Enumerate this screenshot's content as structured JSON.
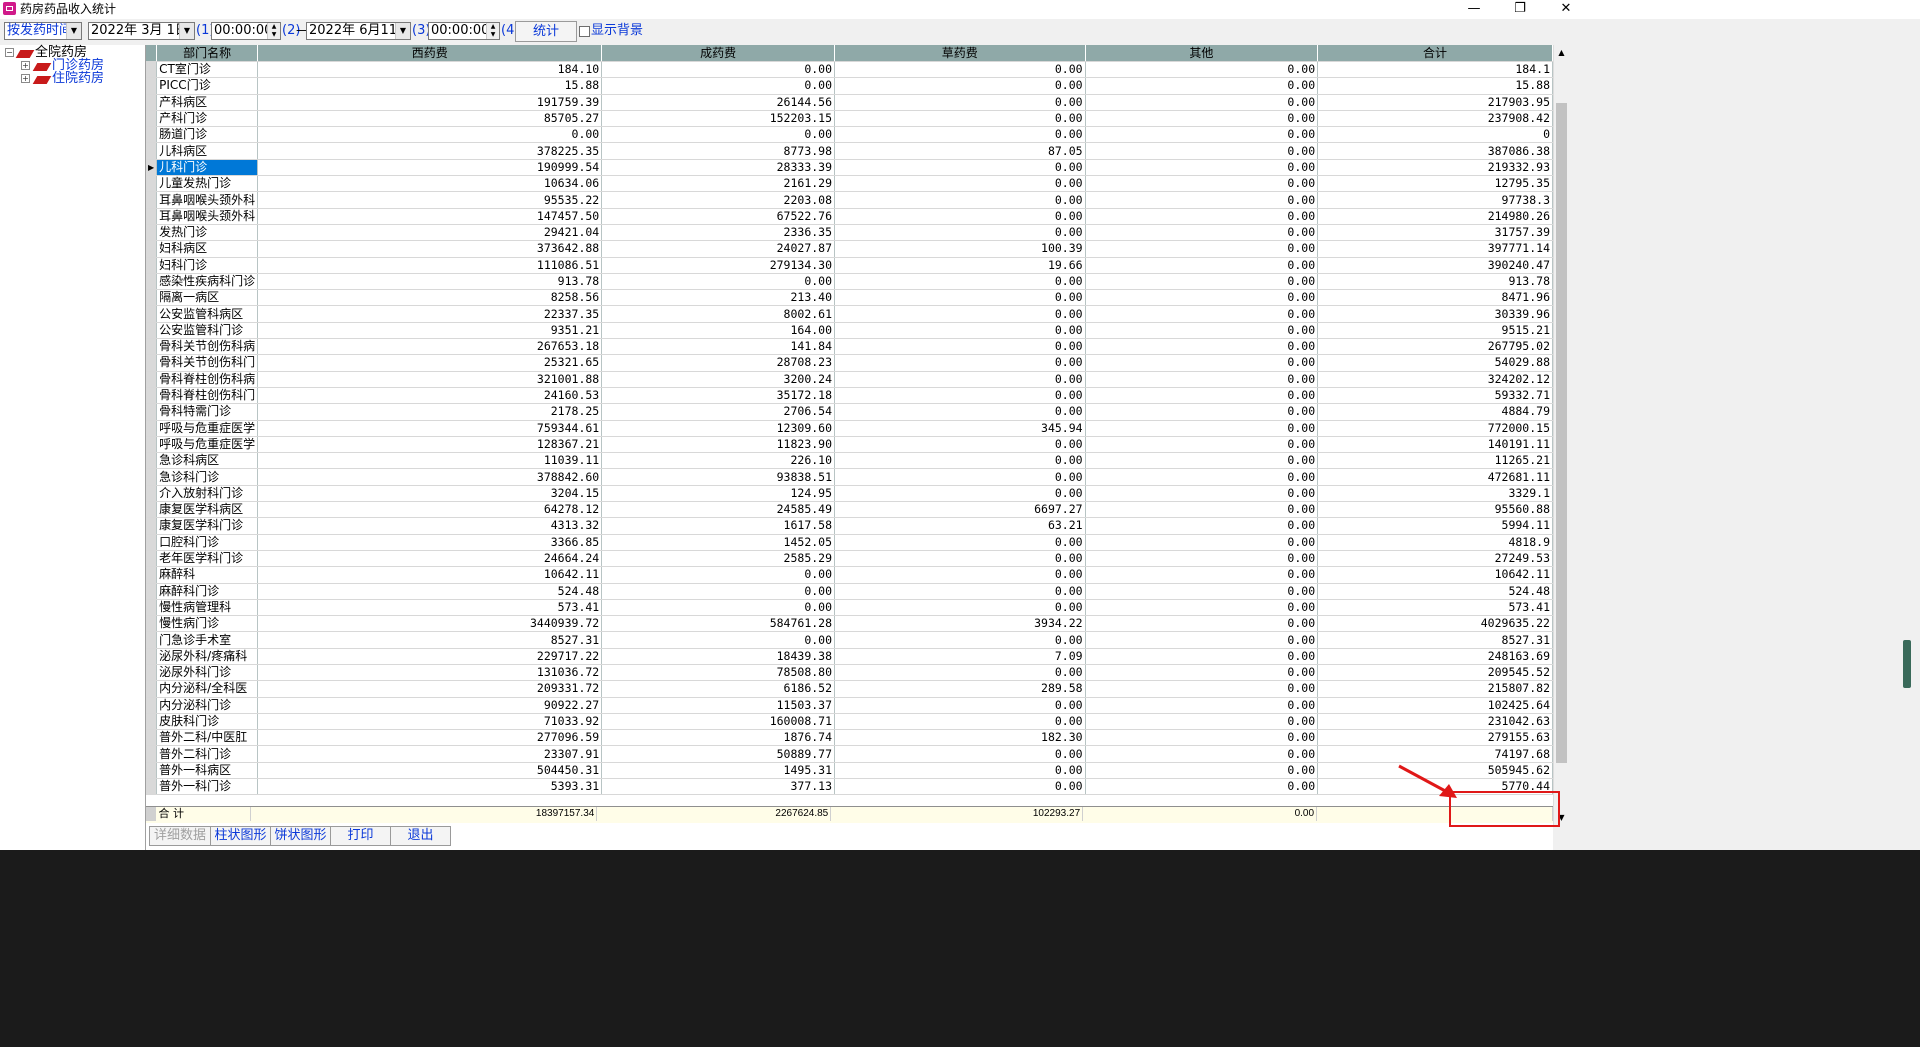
{
  "window": {
    "title": "药房药品收入统计",
    "minimize_icon": "minimize-icon",
    "maximize_icon": "restore-icon",
    "close_icon": "close-icon"
  },
  "toolbar": {
    "mode_select": "按发药时间",
    "start_date": "2022年  3月 1日",
    "start_time": "00:00:00",
    "marker1": "(1)",
    "marker2": "(2)",
    "separator": "—",
    "end_date": "2022年  6月11日",
    "marker3": "(3)",
    "end_time": "00:00:00",
    "marker4": "(4)",
    "stat_button": "统计",
    "show_background_label": "显示背景",
    "show_background_checked": false
  },
  "tree": {
    "root": "全院药房",
    "children": [
      "门诊药房",
      "住院药房"
    ],
    "link_color": "#0a38d8"
  },
  "grid": {
    "header_color": "#8fa9a8",
    "columns": [
      "部门名称",
      "西药费",
      "成药费",
      "草药费",
      "其他",
      "合计"
    ],
    "selected_row": 6,
    "rows": [
      [
        "CT室门诊",
        "184.10",
        "0.00",
        "0.00",
        "0.00",
        "184.1"
      ],
      [
        "PICC门诊",
        "15.88",
        "0.00",
        "0.00",
        "0.00",
        "15.88"
      ],
      [
        "产科病区",
        "191759.39",
        "26144.56",
        "0.00",
        "0.00",
        "217903.95"
      ],
      [
        "产科门诊",
        "85705.27",
        "152203.15",
        "0.00",
        "0.00",
        "237908.42"
      ],
      [
        "肠道门诊",
        "0.00",
        "0.00",
        "0.00",
        "0.00",
        "0"
      ],
      [
        "儿科病区",
        "378225.35",
        "8773.98",
        "87.05",
        "0.00",
        "387086.38"
      ],
      [
        "儿科门诊",
        "190999.54",
        "28333.39",
        "0.00",
        "0.00",
        "219332.93"
      ],
      [
        "儿童发热门诊",
        "10634.06",
        "2161.29",
        "0.00",
        "0.00",
        "12795.35"
      ],
      [
        "耳鼻咽喉头颈外科",
        "95535.22",
        "2203.08",
        "0.00",
        "0.00",
        "97738.3"
      ],
      [
        "耳鼻咽喉头颈外科",
        "147457.50",
        "67522.76",
        "0.00",
        "0.00",
        "214980.26"
      ],
      [
        "发热门诊",
        "29421.04",
        "2336.35",
        "0.00",
        "0.00",
        "31757.39"
      ],
      [
        "妇科病区",
        "373642.88",
        "24027.87",
        "100.39",
        "0.00",
        "397771.14"
      ],
      [
        "妇科门诊",
        "111086.51",
        "279134.30",
        "19.66",
        "0.00",
        "390240.47"
      ],
      [
        "感染性疾病科门诊",
        "913.78",
        "0.00",
        "0.00",
        "0.00",
        "913.78"
      ],
      [
        "隔离一病区",
        "8258.56",
        "213.40",
        "0.00",
        "0.00",
        "8471.96"
      ],
      [
        "公安监管科病区",
        "22337.35",
        "8002.61",
        "0.00",
        "0.00",
        "30339.96"
      ],
      [
        "公安监管科门诊",
        "9351.21",
        "164.00",
        "0.00",
        "0.00",
        "9515.21"
      ],
      [
        "骨科关节创伤科病",
        "267653.18",
        "141.84",
        "0.00",
        "0.00",
        "267795.02"
      ],
      [
        "骨科关节创伤科门",
        "25321.65",
        "28708.23",
        "0.00",
        "0.00",
        "54029.88"
      ],
      [
        "骨科脊柱创伤科病",
        "321001.88",
        "3200.24",
        "0.00",
        "0.00",
        "324202.12"
      ],
      [
        "骨科脊柱创伤科门",
        "24160.53",
        "35172.18",
        "0.00",
        "0.00",
        "59332.71"
      ],
      [
        "骨科特需门诊",
        "2178.25",
        "2706.54",
        "0.00",
        "0.00",
        "4884.79"
      ],
      [
        "呼吸与危重症医学",
        "759344.61",
        "12309.60",
        "345.94",
        "0.00",
        "772000.15"
      ],
      [
        "呼吸与危重症医学",
        "128367.21",
        "11823.90",
        "0.00",
        "0.00",
        "140191.11"
      ],
      [
        "急诊科病区",
        "11039.11",
        "226.10",
        "0.00",
        "0.00",
        "11265.21"
      ],
      [
        "急诊科门诊",
        "378842.60",
        "93838.51",
        "0.00",
        "0.00",
        "472681.11"
      ],
      [
        "介入放射科门诊",
        "3204.15",
        "124.95",
        "0.00",
        "0.00",
        "3329.1"
      ],
      [
        "康复医学科病区",
        "64278.12",
        "24585.49",
        "6697.27",
        "0.00",
        "95560.88"
      ],
      [
        "康复医学科门诊",
        "4313.32",
        "1617.58",
        "63.21",
        "0.00",
        "5994.11"
      ],
      [
        "口腔科门诊",
        "3366.85",
        "1452.05",
        "0.00",
        "0.00",
        "4818.9"
      ],
      [
        "老年医学科门诊",
        "24664.24",
        "2585.29",
        "0.00",
        "0.00",
        "27249.53"
      ],
      [
        "麻醉科",
        "10642.11",
        "0.00",
        "0.00",
        "0.00",
        "10642.11"
      ],
      [
        "麻醉科门诊",
        "524.48",
        "0.00",
        "0.00",
        "0.00",
        "524.48"
      ],
      [
        "慢性病管理科",
        "573.41",
        "0.00",
        "0.00",
        "0.00",
        "573.41"
      ],
      [
        "慢性病门诊",
        "3440939.72",
        "584761.28",
        "3934.22",
        "0.00",
        "4029635.22"
      ],
      [
        "门急诊手术室",
        "8527.31",
        "0.00",
        "0.00",
        "0.00",
        "8527.31"
      ],
      [
        "泌尿外科/疼痛科",
        "229717.22",
        "18439.38",
        "7.09",
        "0.00",
        "248163.69"
      ],
      [
        "泌尿外科门诊",
        "131036.72",
        "78508.80",
        "0.00",
        "0.00",
        "209545.52"
      ],
      [
        "内分泌科/全科医",
        "209331.72",
        "6186.52",
        "289.58",
        "0.00",
        "215807.82"
      ],
      [
        "内分泌科门诊",
        "90922.27",
        "11503.37",
        "0.00",
        "0.00",
        "102425.64"
      ],
      [
        "皮肤科门诊",
        "71033.92",
        "160008.71",
        "0.00",
        "0.00",
        "231042.63"
      ],
      [
        "普外二科/中医肛",
        "277096.59",
        "1876.74",
        "182.30",
        "0.00",
        "279155.63"
      ],
      [
        "普外二科门诊",
        "23307.91",
        "50889.77",
        "0.00",
        "0.00",
        "74197.68"
      ],
      [
        "普外一科病区",
        "504450.31",
        "1495.31",
        "0.00",
        "0.00",
        "505945.62"
      ],
      [
        "普外一科门诊",
        "5393.31",
        "377.13",
        "0.00",
        "0.00",
        "5770.44"
      ]
    ],
    "total": {
      "label": "合 计",
      "west": "18397157.34",
      "patent": "2267624.85",
      "herbal": "102293.27",
      "other": "0.00",
      "sum": ""
    }
  },
  "bottom_buttons": {
    "detail": "详细数据",
    "bar_chart": "柱状图形",
    "pie_chart": "饼状图形",
    "print": "打印",
    "exit": "退出"
  },
  "annotation_color": "#e01818"
}
